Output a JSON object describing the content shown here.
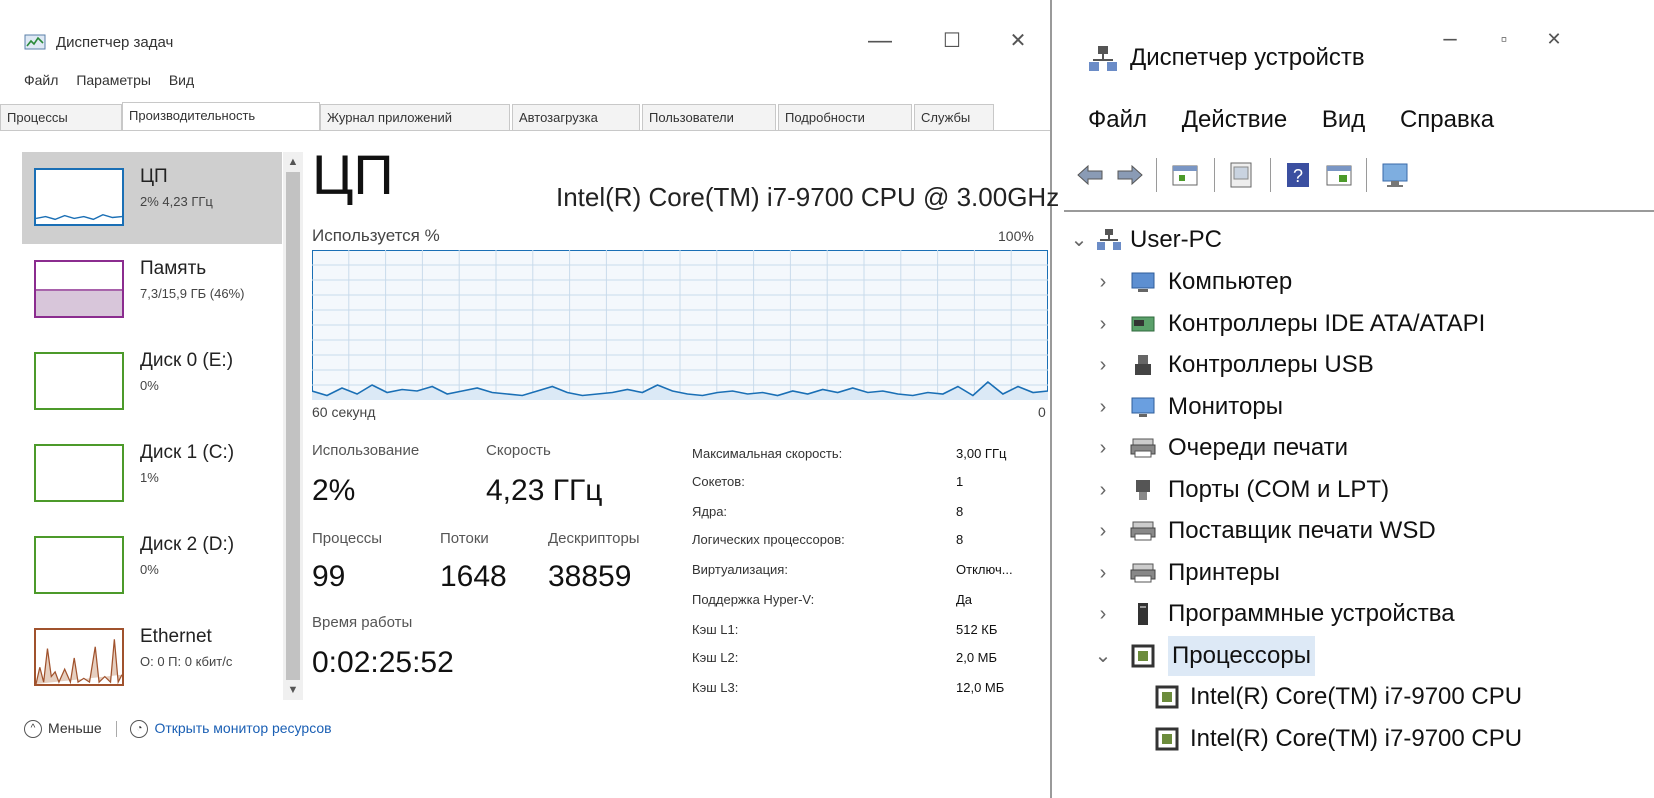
{
  "task_manager": {
    "title": "Диспетчер задач",
    "menu": [
      "Файл",
      "Параметры",
      "Вид"
    ],
    "tabs": [
      "Процессы",
      "Производительность",
      "Журнал приложений",
      "Автозагрузка",
      "Пользователи",
      "Подробности",
      "Службы"
    ],
    "active_tab": "Производительность",
    "window_buttons": {
      "minimize": "—",
      "maximize": "☐",
      "close": "✕"
    },
    "sidebar": [
      {
        "name": "ЦП",
        "sub": "2% 4,23 ГГц",
        "color": "#1a6fb5"
      },
      {
        "name": "Память",
        "sub": "7,3/15,9 ГБ (46%)",
        "color": "#8b2c8f"
      },
      {
        "name": "Диск 0 (E:)",
        "sub": "0%",
        "color": "#4c9a2a"
      },
      {
        "name": "Диск 1 (C:)",
        "sub": "1%",
        "color": "#4c9a2a"
      },
      {
        "name": "Диск 2 (D:)",
        "sub": "0%",
        "color": "#4c9a2a"
      },
      {
        "name": "Ethernet",
        "sub": "О: 0 П: 0 кбит/с",
        "color": "#a0522d"
      }
    ],
    "main": {
      "heading": "ЦП",
      "model": "Intel(R) Core(TM) i7-9700 CPU @ 3.00GHz",
      "graph_label_left": "Используется %",
      "graph_label_right": "100%",
      "graph_time_label": "60 секунд",
      "graph_zero_label": "0",
      "graph_series": [
        6,
        3,
        8,
        4,
        10,
        5,
        7,
        6,
        9,
        4,
        6,
        8,
        5,
        4,
        3,
        6,
        9,
        5,
        3,
        4,
        5,
        7,
        5,
        10,
        6,
        4,
        3,
        5,
        6,
        4,
        5,
        3,
        6,
        4,
        7,
        5,
        8,
        5,
        6,
        4,
        3,
        5,
        4,
        9,
        3,
        12,
        4,
        9,
        5,
        6
      ],
      "stats": {
        "usage_label": "Использование",
        "usage_value": "2%",
        "speed_label": "Скорость",
        "speed_value": "4,23 ГГц",
        "processes_label": "Процессы",
        "processes_value": "99",
        "threads_label": "Потоки",
        "threads_value": "1648",
        "handles_label": "Дескрипторы",
        "handles_value": "38859",
        "uptime_label": "Время работы",
        "uptime_value": "0:02:25:52"
      },
      "specs": [
        {
          "k": "Максимальная скорость:",
          "v": "3,00 ГГц"
        },
        {
          "k": "Сокетов:",
          "v": "1"
        },
        {
          "k": "Ядра:",
          "v": "8"
        },
        {
          "k": "Логических процессоров:",
          "v": "8"
        },
        {
          "k": "Виртуализация:",
          "v": "Отключ..."
        },
        {
          "k": "Поддержка Hyper-V:",
          "v": "Да"
        },
        {
          "k": "Кэш L1:",
          "v": "512 КБ"
        },
        {
          "k": "Кэш L2:",
          "v": "2,0 МБ"
        },
        {
          "k": "Кэш L3:",
          "v": "12,0 МБ"
        }
      ]
    },
    "footer": {
      "less": "Меньше",
      "open_monitor": "Открыть монитор ресурсов"
    }
  },
  "device_manager": {
    "title": "Диспетчер устройств",
    "menu": [
      "Файл",
      "Действие",
      "Вид",
      "Справка"
    ],
    "root": "User-PC",
    "categories": [
      {
        "label": "Компьютер",
        "icon": "computer-icon"
      },
      {
        "label": "Контроллеры IDE ATA/ATAPI",
        "icon": "ide-controller-icon"
      },
      {
        "label": "Контроллеры USB",
        "icon": "usb-icon"
      },
      {
        "label": "Мониторы",
        "icon": "monitor-icon"
      },
      {
        "label": "Очереди печати",
        "icon": "printer-queue-icon"
      },
      {
        "label": "Порты (COM и LPT)",
        "icon": "port-icon"
      },
      {
        "label": "Поставщик печати WSD",
        "icon": "printer-icon"
      },
      {
        "label": "Принтеры",
        "icon": "printer-icon"
      },
      {
        "label": "Программные устройства",
        "icon": "software-device-icon"
      },
      {
        "label": "Процессоры",
        "icon": "processor-icon"
      }
    ],
    "processors": [
      "Intel(R) Core(TM) i7-9700 CPU",
      "Intel(R) Core(TM) i7-9700 CPU"
    ]
  }
}
